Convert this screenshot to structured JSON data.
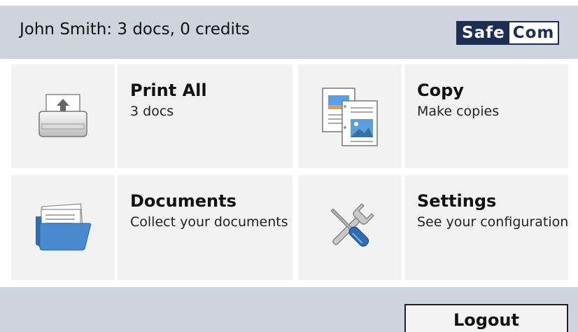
{
  "header": {
    "status_text": "John Smith: 3 docs, 0 credits",
    "logo": {
      "part1": "Safe",
      "part2": "Com",
      "dark": "#1c2f52"
    }
  },
  "tiles": [
    {
      "title": "Print All",
      "subtitle": "3 docs",
      "icon": "printer-icon"
    },
    {
      "title": "Copy",
      "subtitle": "Make copies",
      "icon": "copy-documents-icon"
    },
    {
      "title": "Documents",
      "subtitle": "Collect your documents",
      "icon": "folder-icon"
    },
    {
      "title": "Settings",
      "subtitle": "See your configuration",
      "icon": "wrench-screwdriver-icon"
    }
  ],
  "footer": {
    "logout_label": "Logout"
  },
  "colors": {
    "bar": "#cdd4de",
    "tile": "#f2f2f2",
    "folder": "#4a8ad0"
  }
}
